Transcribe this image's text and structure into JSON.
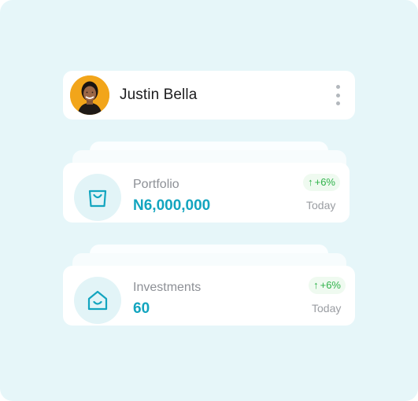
{
  "user": {
    "name": "Justin Bella"
  },
  "cards": [
    {
      "label": "Portfolio",
      "value": "N6,000,000",
      "change": "+6%",
      "period": "Today",
      "icon": "shopping-bag-icon"
    },
    {
      "label": "Investments",
      "value": "60",
      "change": "+6%",
      "period": "Today",
      "icon": "house-icon"
    }
  ],
  "colors": {
    "accent": "#13a5bf",
    "positive": "#2fb24a",
    "background": "#e6f6f9"
  }
}
